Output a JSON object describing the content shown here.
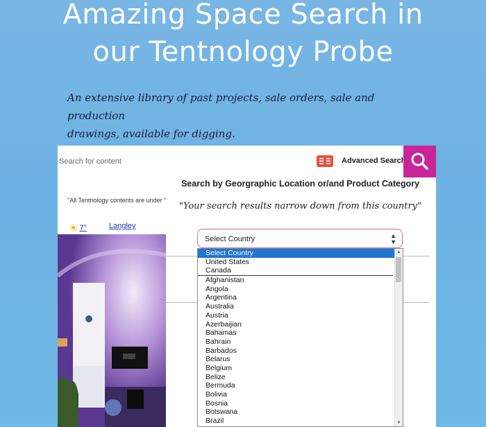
{
  "header": {
    "title_line1": "Amazing Space Search in",
    "title_line2": "our Tentnology Probe",
    "subtitle_line1": "An extensive library of past projects, sale orders, sale and production",
    "subtitle_line2": "drawings, available for digging."
  },
  "search": {
    "placeholder": "Search for content",
    "advanced_label": "Advanced Search",
    "advanced_icon": "book-icon",
    "button_icon": "magnifier-icon",
    "button_color": "#c8259a"
  },
  "sidebar": {
    "notice": "\"All Tentnology contents are under \"",
    "weather_icon": "sun-icon",
    "temperature": "7°",
    "city": "Langley"
  },
  "panel": {
    "heading": "Search by Georgraphic Location or/and Product Category",
    "quote": "\"Your search results narrow down from this country\"",
    "select_value": "Select Country",
    "options": [
      "Select Country",
      "United States",
      "Canada",
      "Afghanistan",
      "Angola",
      "Argentina",
      "Australia",
      "Austria",
      "Azerbaijian",
      "Bahamas",
      "Bahrain",
      "Barbados",
      "Belarus",
      "Belgium",
      "Belize",
      "Bermuda",
      "Bolivia",
      "Bosnia",
      "Botswana",
      "Brazil"
    ]
  },
  "colors": {
    "background": "#79b6e3",
    "accent": "#c8259a",
    "selected_option": "#1e77d2"
  }
}
